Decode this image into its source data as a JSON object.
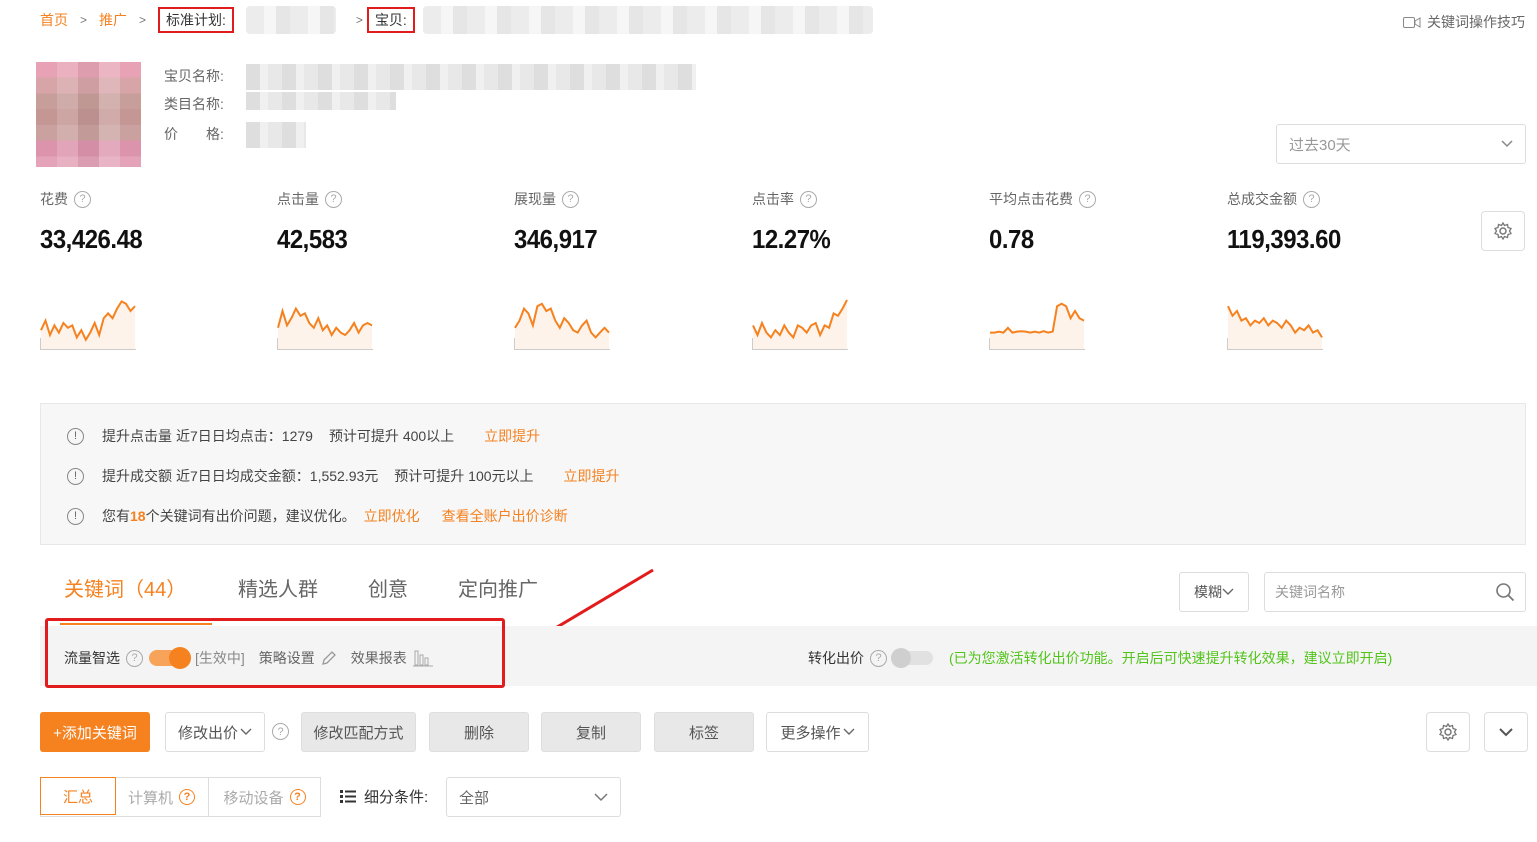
{
  "breadcrumb": {
    "home": "首页",
    "promo": "推广",
    "plan_label": "标准计划:",
    "item_label": "宝贝:"
  },
  "header": {
    "tips_link": "关键词操作技巧"
  },
  "product": {
    "name_label": "宝贝名称:",
    "category_label": "类目名称:",
    "price_label": "价　　格:"
  },
  "date_range": {
    "selected": "过去30天"
  },
  "metrics": [
    {
      "label": "花费",
      "value": "33,426.48"
    },
    {
      "label": "点击量",
      "value": "42,583"
    },
    {
      "label": "展现量",
      "value": "346,917"
    },
    {
      "label": "点击率",
      "value": "12.27%"
    },
    {
      "label": "平均点击花费",
      "value": "0.78"
    },
    {
      "label": "总成交金额",
      "value": "119,393.60"
    }
  ],
  "suggestions": [
    {
      "title": "提升点击量",
      "detail": "近7日日均点击：1279",
      "estimate": "预计可提升 400以上",
      "action": "立即提升"
    },
    {
      "title": "提升成交额",
      "detail": "近7日日均成交金额：1,552.93元",
      "estimate": "预计可提升 100元以上",
      "action": "立即提升"
    },
    {
      "prefix": "您有",
      "count": "18",
      "suffix": "个关键词有出价问题，建议优化。",
      "action": "立即优化",
      "action2": "查看全账户出价诊断"
    }
  ],
  "tabs": [
    {
      "label": "关键词（44）"
    },
    {
      "label": "精选人群"
    },
    {
      "label": "创意"
    },
    {
      "label": "定向推广"
    }
  ],
  "search": {
    "match_mode": "模糊",
    "placeholder": "关键词名称"
  },
  "traffic": {
    "smart_label": "流量智选",
    "status": "[生效中]",
    "strategy": "策略设置",
    "report": "效果报表",
    "convert_label": "转化出价",
    "convert_hint": "(已为您激活转化出价功能。开启后可快速提升转化效果，建议立即开启)"
  },
  "actions": {
    "add": "+添加关键词",
    "modify_bid": "修改出价",
    "modify_match": "修改匹配方式",
    "delete": "删除",
    "copy": "复制",
    "tag": "标签",
    "more": "更多操作"
  },
  "device_tabs": [
    {
      "label": "汇总"
    },
    {
      "label": "计算机"
    },
    {
      "label": "移动设备"
    }
  ],
  "filter": {
    "label": "细分条件:",
    "selected": "全部"
  },
  "colors": {
    "accent": "#f5811f",
    "highlight_box": "#e21c1c",
    "hint_green": "#52c41a"
  },
  "sparklines": [
    [
      0.35,
      0.55,
      0.25,
      0.45,
      0.3,
      0.5,
      0.4,
      0.45,
      0.2,
      0.35,
      0.15,
      0.3,
      0.5,
      0.25,
      0.6,
      0.7,
      0.6,
      0.8,
      0.95,
      0.9,
      0.75,
      0.85
    ],
    [
      0.4,
      0.75,
      0.45,
      0.6,
      0.8,
      0.65,
      0.7,
      0.5,
      0.4,
      0.6,
      0.35,
      0.45,
      0.25,
      0.4,
      0.3,
      0.25,
      0.35,
      0.5,
      0.3,
      0.45,
      0.5,
      0.45
    ],
    [
      0.4,
      0.55,
      0.8,
      0.7,
      0.45,
      0.85,
      0.9,
      0.75,
      0.8,
      0.55,
      0.4,
      0.6,
      0.5,
      0.35,
      0.3,
      0.45,
      0.55,
      0.3,
      0.2,
      0.3,
      0.4,
      0.3
    ],
    [
      0.45,
      0.25,
      0.5,
      0.3,
      0.2,
      0.35,
      0.25,
      0.45,
      0.3,
      0.2,
      0.45,
      0.4,
      0.3,
      0.45,
      0.5,
      0.25,
      0.45,
      0.4,
      0.7,
      0.65,
      0.8,
      0.98
    ],
    [
      0.3,
      0.3,
      0.32,
      0.3,
      0.4,
      0.3,
      0.32,
      0.33,
      0.32,
      0.3,
      0.32,
      0.3,
      0.33,
      0.3,
      0.32,
      0.85,
      0.9,
      0.85,
      0.6,
      0.75,
      0.6,
      0.55
    ],
    [
      0.85,
      0.65,
      0.75,
      0.55,
      0.6,
      0.45,
      0.55,
      0.5,
      0.6,
      0.45,
      0.55,
      0.5,
      0.4,
      0.55,
      0.45,
      0.3,
      0.4,
      0.35,
      0.45,
      0.3,
      0.35,
      0.2
    ]
  ]
}
